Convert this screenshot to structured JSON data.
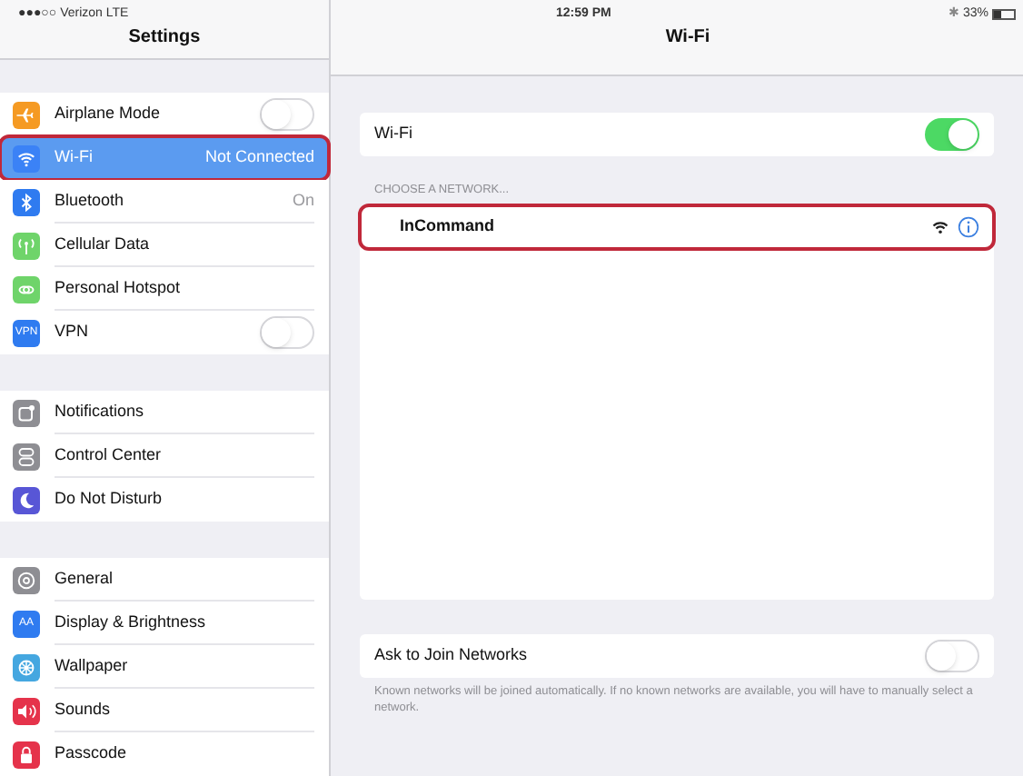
{
  "status_bar": {
    "carrier": "●●●○○ Verizon  LTE",
    "time": "12:59 PM",
    "bluetooth": "✱",
    "battery": "33%"
  },
  "sidebar": {
    "title": "Settings",
    "groups": [
      [
        {
          "label": "Airplane Mode",
          "kind": "airplane",
          "color": "#f59a23",
          "on": false,
          "selected": false,
          "highlighted": false
        },
        {
          "label": "Wi-Fi",
          "value": "Not Connected",
          "kind": "wifi",
          "color": "#3b82f6",
          "selected": true,
          "highlighted": true
        },
        {
          "label": "Bluetooth",
          "value": "On",
          "kind": "bluetooth",
          "color": "#2f7bf0",
          "selected": false,
          "highlighted": false
        },
        {
          "label": "Cellular Data",
          "kind": "antenna",
          "color": "#6fd46a",
          "selected": false,
          "highlighted": false
        },
        {
          "label": "Personal Hotspot",
          "kind": "chain",
          "color": "#6fd46a",
          "selected": false,
          "highlighted": false
        },
        {
          "label": "VPN",
          "badge": "VPN",
          "kind": "text",
          "color": "#2f7bf0",
          "on": false,
          "selected": false,
          "highlighted": false
        }
      ],
      [
        {
          "label": "Notifications",
          "kind": "square",
          "color": "#8e8e93",
          "selected": false,
          "highlighted": false
        },
        {
          "label": "Control Center",
          "kind": "switches",
          "color": "#8e8e93",
          "selected": false,
          "highlighted": false
        },
        {
          "label": "Do Not Disturb",
          "kind": "moon",
          "color": "#5856d6",
          "selected": false,
          "highlighted": false
        }
      ],
      [
        {
          "label": "General",
          "kind": "gear",
          "color": "#8e8e93",
          "selected": false,
          "highlighted": false
        },
        {
          "label": "Display & Brightness",
          "badge": "AA",
          "kind": "text",
          "color": "#2f7bf0",
          "selected": false,
          "highlighted": false
        },
        {
          "label": "Wallpaper",
          "kind": "flower",
          "color": "#45a7e0",
          "selected": false,
          "highlighted": false
        },
        {
          "label": "Sounds",
          "kind": "speaker",
          "color": "#e5334b",
          "selected": false,
          "highlighted": false
        },
        {
          "label": "Passcode",
          "kind": "lock",
          "color": "#e5334b",
          "selected": false,
          "highlighted": false
        }
      ]
    ]
  },
  "detail": {
    "title": "Wi-Fi",
    "wifi_row": {
      "label": "Wi-Fi",
      "on": true
    },
    "section_header": "CHOOSE A NETWORK...",
    "networks": [
      {
        "name": "InCommand",
        "highlighted": true
      }
    ],
    "ask_row": {
      "label": "Ask to Join Networks",
      "on": false
    },
    "footer": "Known networks will be joined automatically. If no known networks are available, you will have to manually select a network."
  }
}
